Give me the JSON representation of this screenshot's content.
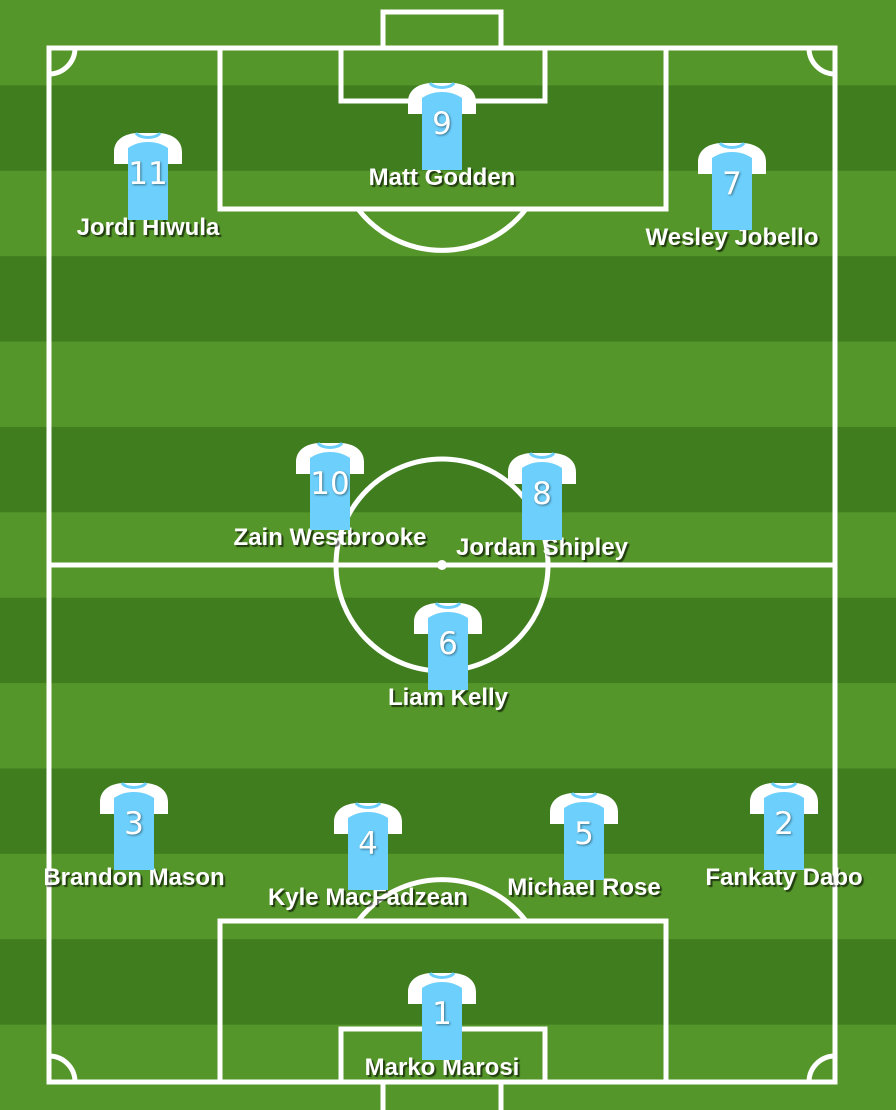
{
  "colors": {
    "stripe_light": "#55962a",
    "stripe_dark": "#3f7d1f",
    "lines": "#ffffff",
    "shirt_body": "#6dcffb",
    "shirt_sleeves": "#ffffff"
  },
  "icons": {
    "shirt": "shirt-icon"
  },
  "players": [
    {
      "number": "9",
      "name": "Matt Godden"
    },
    {
      "number": "11",
      "name": "Jordi Hiwula"
    },
    {
      "number": "7",
      "name": "Wesley Jobello"
    },
    {
      "number": "10",
      "name": "Zain Westbrooke"
    },
    {
      "number": "8",
      "name": "Jordan Shipley"
    },
    {
      "number": "6",
      "name": "Liam Kelly"
    },
    {
      "number": "3",
      "name": "Brandon Mason"
    },
    {
      "number": "4",
      "name": "Kyle MacFadzean"
    },
    {
      "number": "5",
      "name": "Michael Rose"
    },
    {
      "number": "2",
      "name": "Fankaty Dabo"
    },
    {
      "number": "1",
      "name": "Marko Marosi"
    }
  ]
}
